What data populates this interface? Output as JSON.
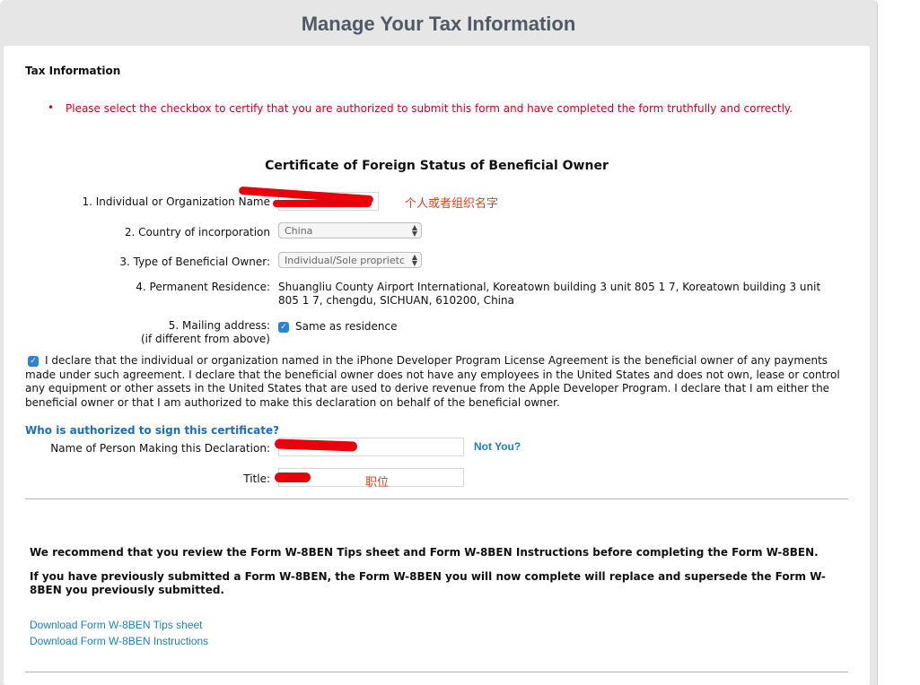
{
  "header": {
    "title": "Manage Your Tax Information"
  },
  "section": {
    "title": "Tax Information",
    "error": "Please select the checkbox to certify that you are authorized to submit this form and have completed the form truthfully and correctly."
  },
  "form": {
    "title": "Certificate of Foreign Status of Beneficial Owner",
    "name_label": "1. Individual or Organization Name",
    "name_note": "个人或者组织名字",
    "country_label": "2. Country of incorporation",
    "country_value": "China",
    "owner_type_label": "3. Type of Beneficial Owner:",
    "owner_type_value": "Individual/Sole proprietc",
    "residence_label": "4. Permanent Residence:",
    "residence_value": "Shuangliu County Airport International, Koreatown building 3 unit 805 1 7, Koreatown building 3 unit 805 1 7, chengdu, SICHUAN, 610200, China",
    "mailing_label": "5. Mailing address:",
    "mailing_sublabel": "(if different from above)",
    "same_as_residence": "Same as residence",
    "declaration": "I declare that the individual or organization named in the iPhone Developer Program License Agreement is the beneficial owner of any payments made under such agreement. I declare that the beneficial owner does not have any employees in the United States and does not own, lease or control any equipment or other assets in the United States that are used to derive revenue from the Apple Developer Program. I declare that I am either the beneficial owner or that I am authorized to make this declaration on behalf of the beneficial owner."
  },
  "signer": {
    "heading": "Who is authorized to sign this certificate?",
    "name_label": "Name of Person Making this Declaration:",
    "not_you": "Not You?",
    "title_label": "Title:",
    "title_note": "职位"
  },
  "info": {
    "recommend": "We recommend that you review the Form W-8BEN Tips sheet and Form W-8BEN Instructions before completing the Form W-8BEN.",
    "previous": "If you have previously submitted a Form W-8BEN, the Form W-8BEN you will now complete will replace and supersede the Form W-8BEN you previously submitted.",
    "link_tips": "Download Form W-8BEN Tips sheet",
    "link_instructions": "Download Form W-8BEN Instructions"
  },
  "colors": {
    "error": "#d0021b",
    "link": "#1a80c4",
    "checkbox": "#2c82d9",
    "redaction": "#e8000b"
  }
}
